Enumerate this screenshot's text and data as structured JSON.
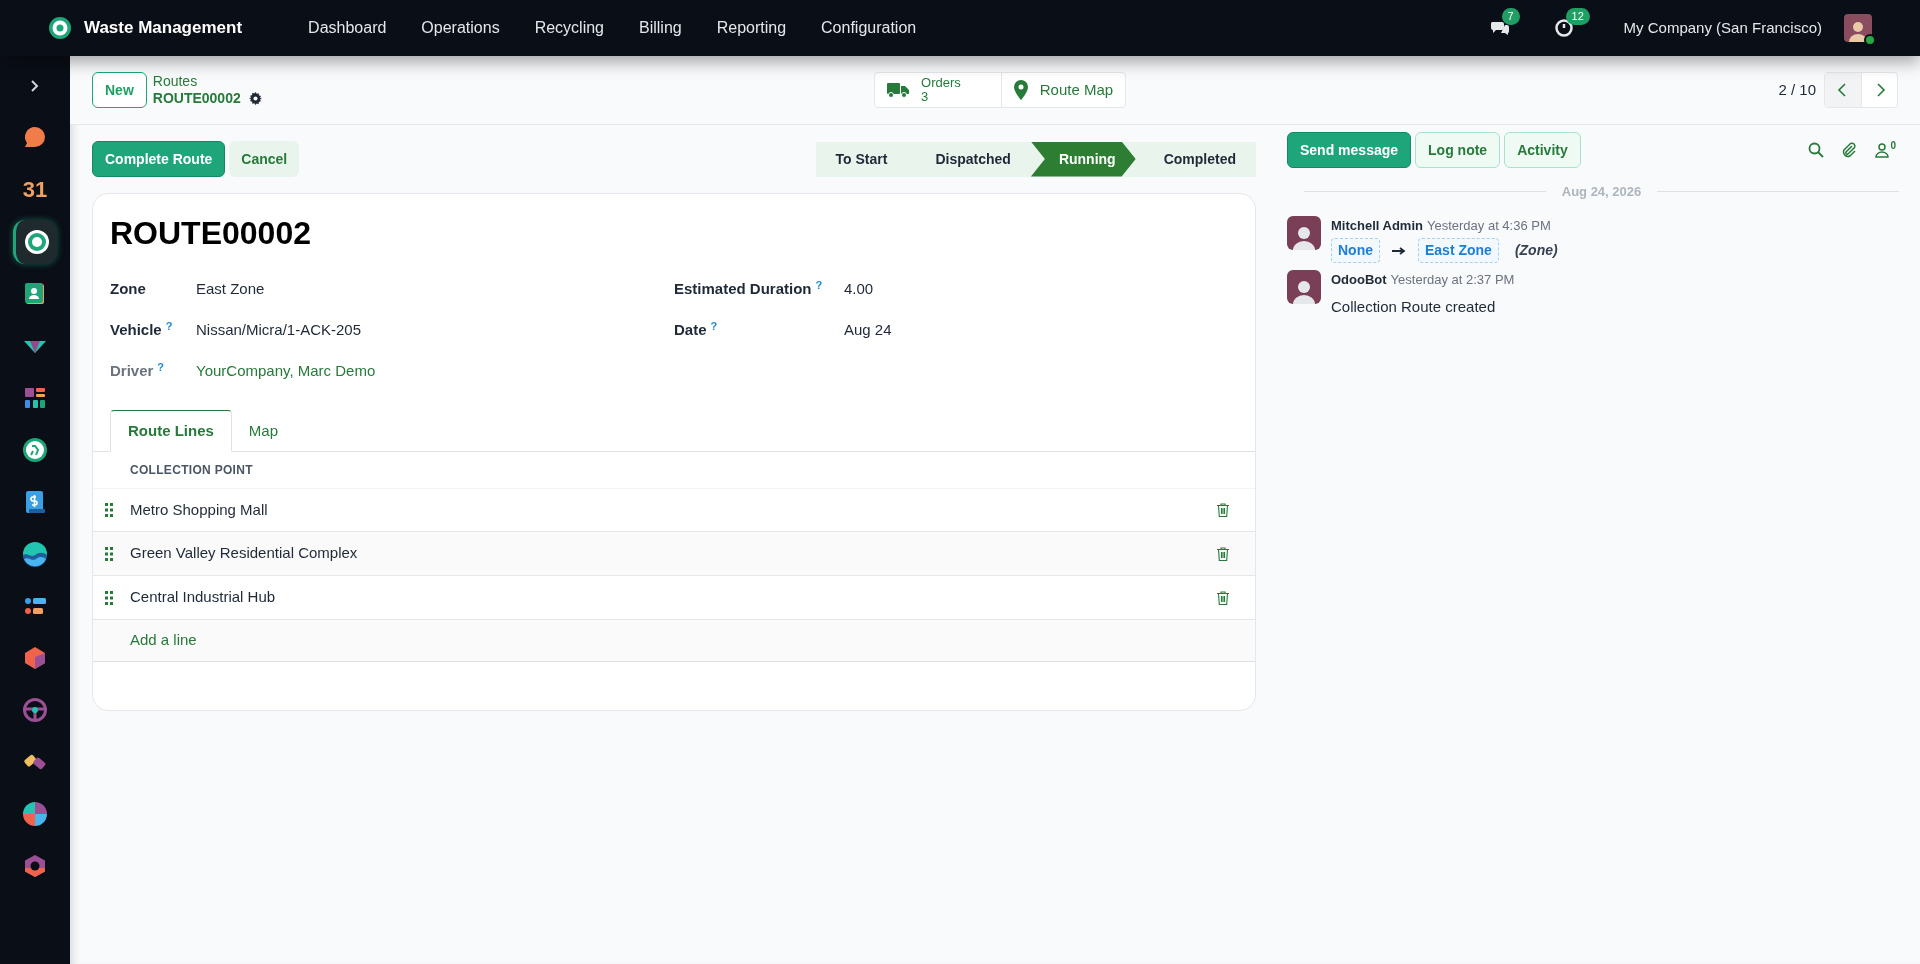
{
  "navbar": {
    "app_name": "Waste Management",
    "menu": [
      "Dashboard",
      "Operations",
      "Recycling",
      "Billing",
      "Reporting",
      "Configuration"
    ],
    "messages_badge": "7",
    "activities_badge": "12",
    "company": "My Company (San Francisco)"
  },
  "sidebar": {
    "apps": [
      {
        "kind": "discuss",
        "selected": false
      },
      {
        "kind": "calendar",
        "label": "31",
        "selected": false
      },
      {
        "kind": "waste",
        "selected": true
      },
      {
        "kind": "contacts",
        "selected": false
      },
      {
        "kind": "crm",
        "selected": false
      },
      {
        "kind": "dashboard",
        "selected": false
      },
      {
        "kind": "timesheet",
        "selected": false
      },
      {
        "kind": "invoice",
        "selected": false
      },
      {
        "kind": "wave",
        "selected": false
      },
      {
        "kind": "list",
        "selected": false
      },
      {
        "kind": "cube",
        "selected": false
      },
      {
        "kind": "wheel",
        "selected": false
      },
      {
        "kind": "links",
        "selected": false
      },
      {
        "kind": "pie",
        "selected": false
      },
      {
        "kind": "hexagon",
        "selected": false
      }
    ]
  },
  "control_panel": {
    "new_button": "New",
    "breadcrumb": "Routes",
    "record": "ROUTE00002",
    "smart_buttons": [
      {
        "kind": "orders",
        "label": "Orders",
        "value": "3"
      },
      {
        "kind": "map",
        "label": "Route Map"
      }
    ],
    "pager": "2 / 10"
  },
  "actions": [
    {
      "label": "Complete Route",
      "kind": "primary"
    },
    {
      "label": "Cancel",
      "kind": "secondary"
    }
  ],
  "stages": [
    {
      "label": "To Start",
      "selected": false
    },
    {
      "label": "Dispatched",
      "selected": false
    },
    {
      "label": "Running",
      "selected": true
    },
    {
      "label": "Completed",
      "selected": false
    }
  ],
  "form": {
    "title": "ROUTE00002",
    "left_fields": [
      {
        "label": "Zone",
        "value": "East Zone",
        "readonly": false,
        "link": false
      },
      {
        "label": "Vehicle",
        "help": "?",
        "value": "Nissan/Micra/1-ACK-205",
        "readonly": false,
        "link": false
      },
      {
        "label": "Driver",
        "help": "?",
        "value": "YourCompany, Marc Demo",
        "readonly": true,
        "link": true
      }
    ],
    "right_fields": [
      {
        "label": "Estimated Duration",
        "help": "?",
        "value": "4.00",
        "readonly": false,
        "link": false
      },
      {
        "label": "Date",
        "help": "?",
        "value": "Aug 24",
        "readonly": false,
        "link": false
      }
    ],
    "tabs": [
      {
        "label": "Route Lines",
        "selected": true
      },
      {
        "label": "Map",
        "selected": false
      }
    ],
    "route_lines": {
      "column": "COLLECTION POINT",
      "rows": [
        "Metro Shopping Mall",
        "Green Valley Residential Complex",
        "Central Industrial Hub"
      ],
      "add_line": "Add a line"
    }
  },
  "chatter": {
    "buttons": [
      {
        "label": "Send message",
        "kind": "primary"
      },
      {
        "label": "Log note",
        "kind": "secondary"
      },
      {
        "label": "Activity",
        "kind": "secondary"
      }
    ],
    "followers": "0",
    "date": "Aug 24, 2026",
    "messages": [
      {
        "kind": "tracking",
        "author": "Mitchell Admin",
        "time": "Yesterday at 4:36 PM",
        "old": "None",
        "new": "East Zone",
        "field": "(Zone)"
      },
      {
        "kind": "text",
        "author": "OdooBot",
        "time": "Yesterday at 2:37 PM",
        "body": "Collection Route created"
      }
    ]
  }
}
